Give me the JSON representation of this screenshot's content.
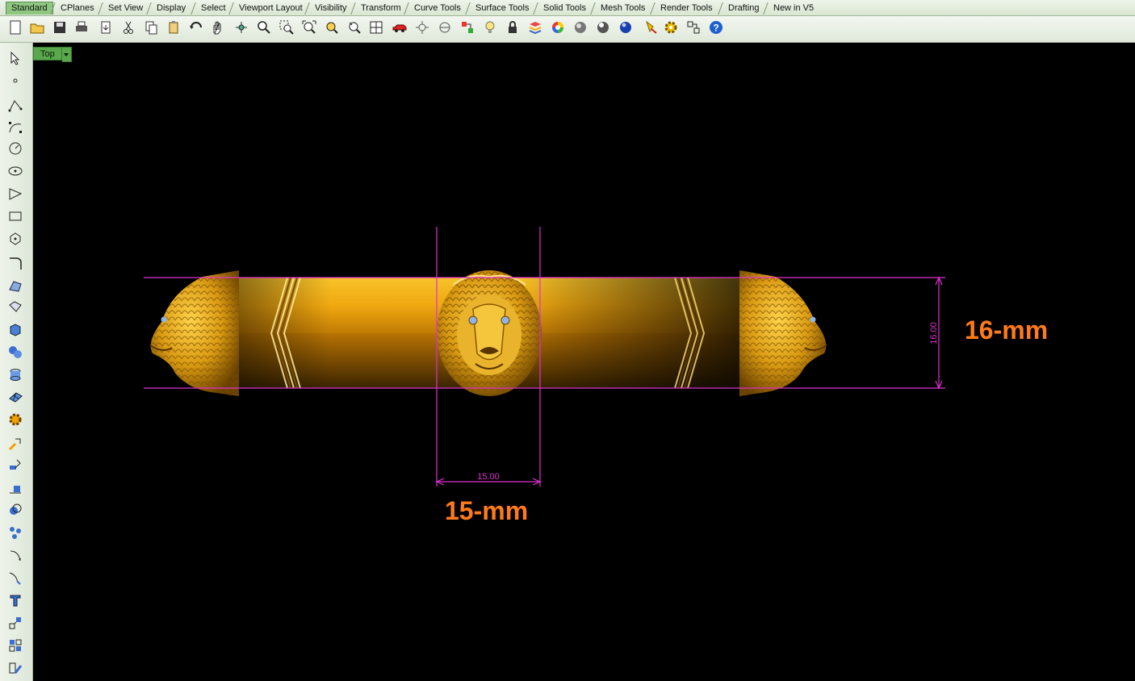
{
  "tabs": [
    "Standard",
    "CPlanes",
    "Set View",
    "Display",
    "Select",
    "Viewport Layout",
    "Visibility",
    "Transform",
    "Curve Tools",
    "Surface Tools",
    "Solid Tools",
    "Mesh Tools",
    "Render Tools",
    "Drafting",
    "New in V5"
  ],
  "toolbar_icons": [
    "new-icon",
    "open-icon",
    "save-icon",
    "print-icon",
    "import-icon",
    "cut-icon",
    "copy-icon",
    "paste-icon",
    "undo-icon",
    "pan-icon",
    "rotate-view-icon",
    "zoom-icon",
    "zoom-window-icon",
    "zoom-extents-icon",
    "zoom-selected-icon",
    "rotate-icon",
    "four-view-icon",
    "car-icon",
    "object-snap-icon",
    "osnap-icon",
    "properties-icon",
    "light-icon",
    "lock-icon",
    "layer-icon",
    "color-wheel-icon",
    "shaded-sphere-icon",
    "rendered-sphere-icon",
    "blue-sphere-icon",
    "paint-icon",
    "settings-icon",
    "analyze-icon",
    "help-icon"
  ],
  "left_tools": [
    "select-arrow-icon",
    "point-icon",
    "polyline-icon",
    "curve-icon",
    "circle-icon",
    "ellipse-icon",
    "polygon-icon",
    "rectangle-icon",
    "hexagon-icon",
    "fillet-icon",
    "surface-points-icon",
    "surface-icon",
    "box-icon",
    "spheres-icon",
    "cylinder-icon",
    "mesh-plane-icon",
    "gears-icon",
    "transform-icon",
    "dimension-icon",
    "align-icon",
    "boolean-icon",
    "group-icon",
    "curve-arc-icon",
    "curve-dim-icon",
    "text-icon",
    "grid-icon",
    "block-icon",
    "edit-icon"
  ],
  "viewport": {
    "title": "Top",
    "dim_width_value": "15.00",
    "dim_height_value": "16.00",
    "label_width": "15-mm",
    "label_height": "16-mm"
  },
  "colors": {
    "viewport_bg": "#000000",
    "dimension": "#e030d0",
    "gold": "#e6a817",
    "label": "#ff7a1a",
    "eye": "#8fb4e8"
  }
}
